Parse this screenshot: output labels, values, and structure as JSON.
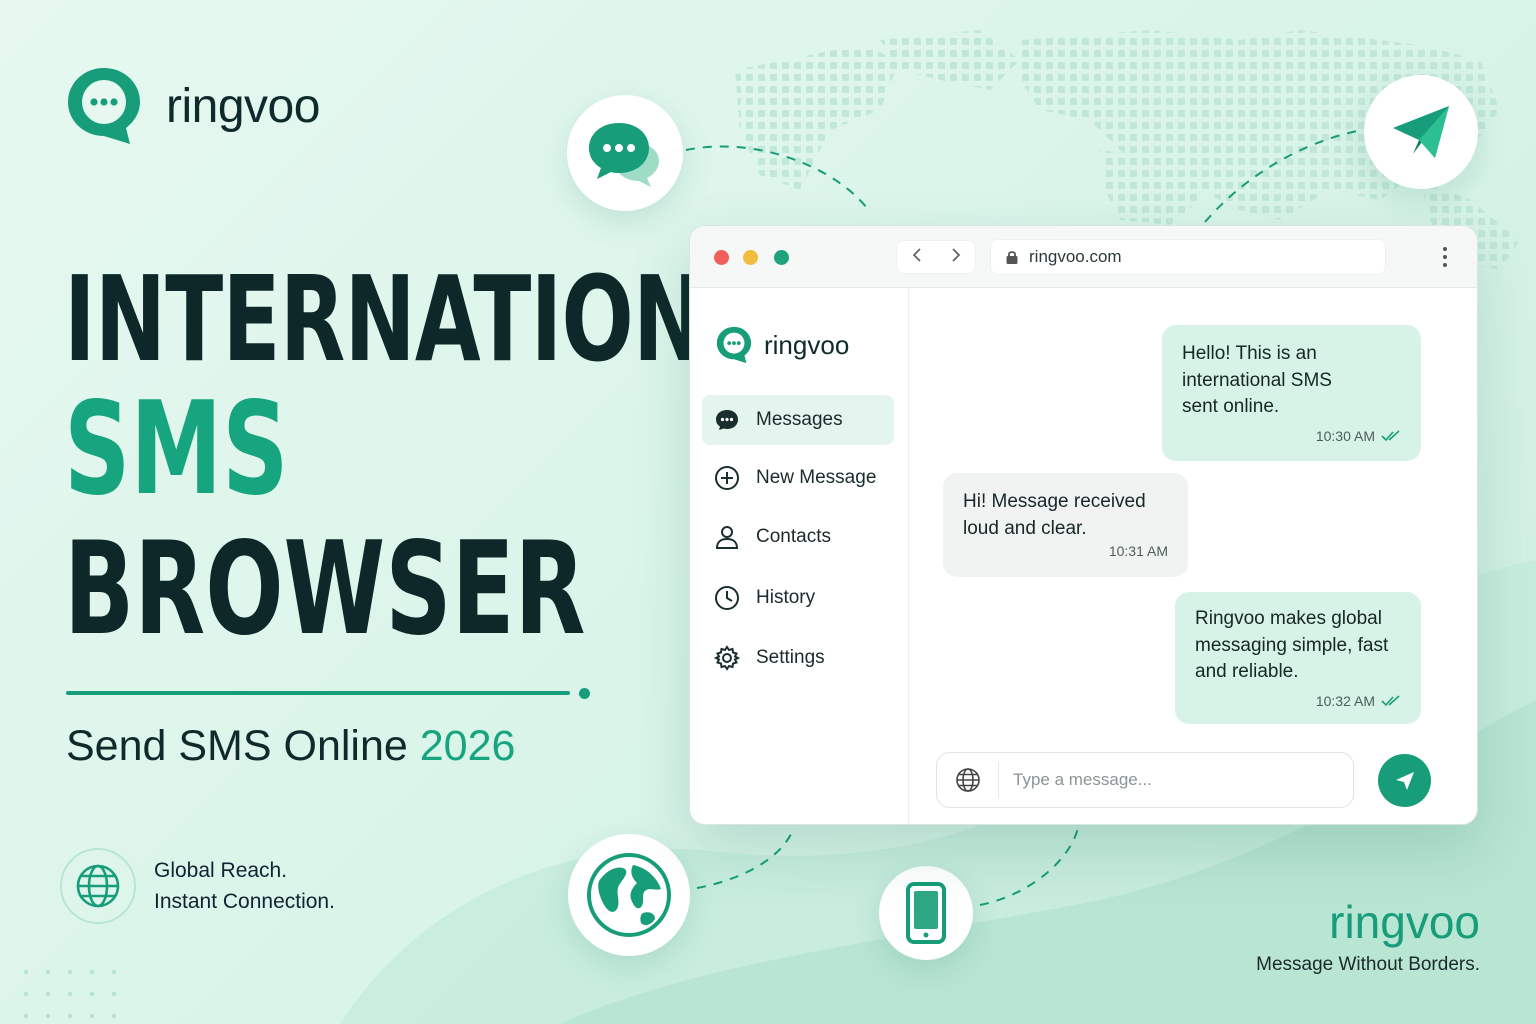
{
  "brand": {
    "name": "ringvoo",
    "accent_color": "#179d79",
    "dark_color": "#0e2829",
    "icon": "chat-bubble-logo-icon"
  },
  "headline": {
    "line1": "INTERNATIONAL",
    "line2": "SMS",
    "line3": "BROWSER"
  },
  "subline": {
    "text": "Send SMS Online",
    "year": "2026"
  },
  "reach": {
    "icon": "globe-icon",
    "line1": "Global Reach.",
    "line2": "Instant Connection."
  },
  "browser": {
    "url": "ringvoo.com",
    "window_controls": [
      "close",
      "minimize",
      "maximize"
    ],
    "sidebar": {
      "brand": "ringvoo",
      "items": [
        {
          "label": "Messages",
          "icon": "messages-icon",
          "active": true
        },
        {
          "label": "New Message",
          "icon": "plus-circle-icon",
          "active": false
        },
        {
          "label": "Contacts",
          "icon": "user-icon",
          "active": false
        },
        {
          "label": "History",
          "icon": "clock-icon",
          "active": false
        },
        {
          "label": "Settings",
          "icon": "gear-icon",
          "active": false
        }
      ]
    },
    "messages": [
      {
        "direction": "out",
        "line1": "Hello! This is an",
        "line2": "international SMS",
        "line3": "sent online.",
        "time": "10:30 AM",
        "read": true
      },
      {
        "direction": "in",
        "line1": "Hi! Message received",
        "line2": "loud and clear.",
        "time": "10:31 AM"
      },
      {
        "direction": "out",
        "line1": "Ringvoo makes global",
        "line2": "messaging simple, fast",
        "line3": "and reliable.",
        "time": "10:32 AM",
        "read": true
      }
    ],
    "composer": {
      "placeholder": "Type a message..."
    }
  },
  "floating_icons": [
    "chat-bubbles-icon",
    "paper-plane-icon",
    "world-globe-icon",
    "smartphone-icon"
  ],
  "footer": {
    "brand": "ringvoo",
    "tagline": "Message Without Borders."
  }
}
